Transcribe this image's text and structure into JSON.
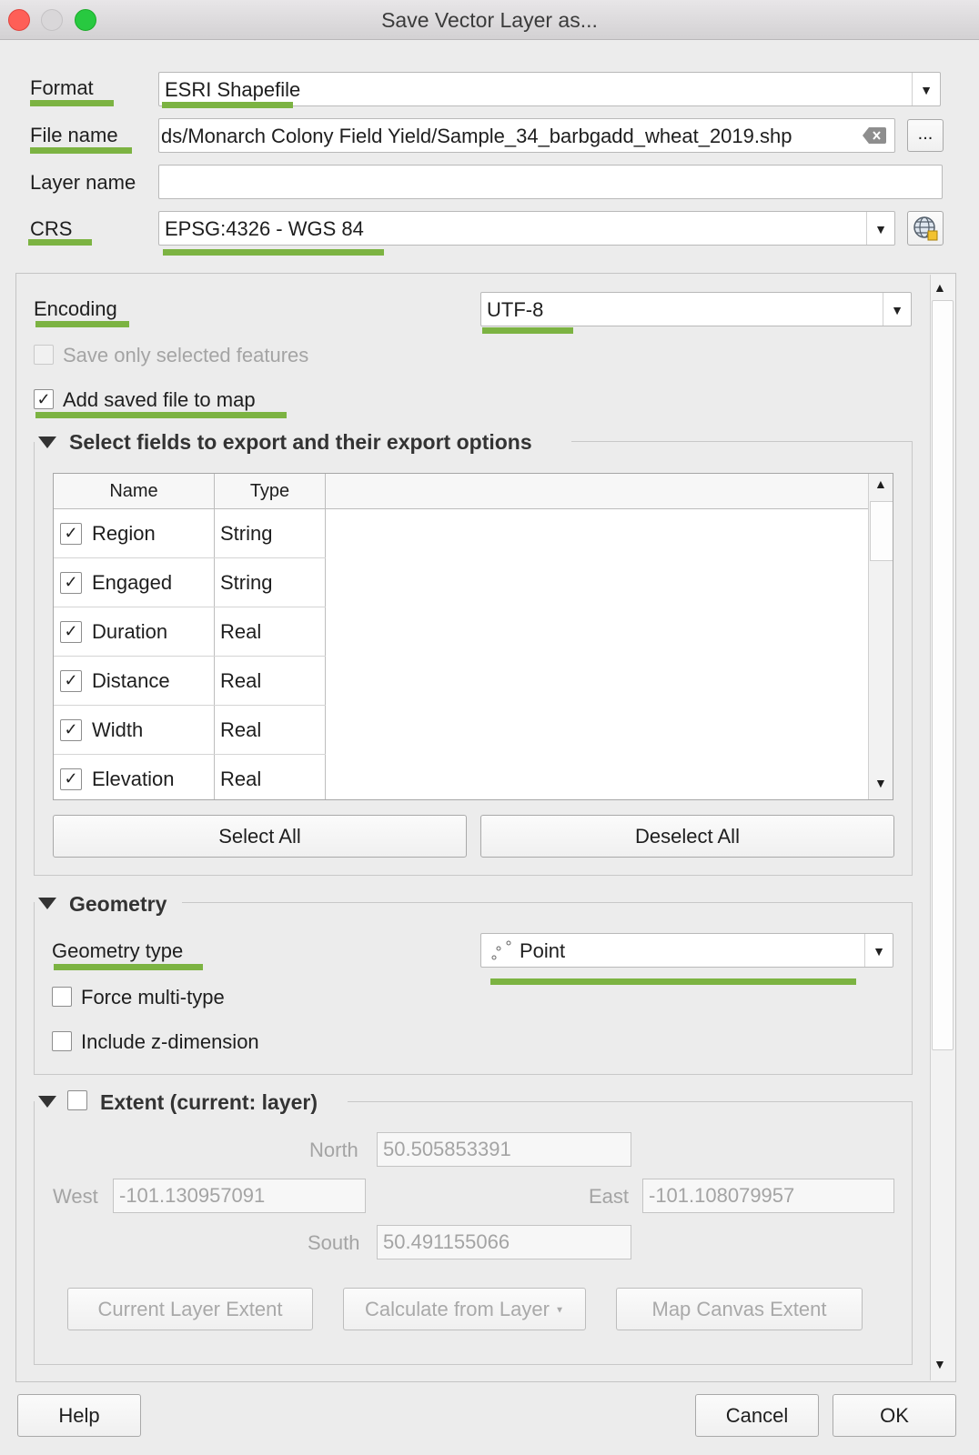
{
  "window": {
    "title": "Save Vector Layer as...",
    "colors": {
      "close": "#fe5f57",
      "minimize": "#d9d7d9",
      "zoom": "#28c940",
      "underline": "#7cb342"
    }
  },
  "form": {
    "format_label": "Format",
    "format_value": "ESRI Shapefile",
    "filename_label": "File name",
    "filename_value": "ds/Monarch Colony Field Yield/Sample_34_barbgadd_wheat_2019.shp",
    "browse_label": "...",
    "layername_label": "Layer name",
    "layername_value": "",
    "crs_label": "CRS",
    "crs_value": "EPSG:4326 - WGS 84"
  },
  "options": {
    "encoding_label": "Encoding",
    "encoding_value": "UTF-8",
    "save_selected_label": "Save only selected features",
    "add_to_map_label": "Add saved file to map",
    "add_to_map_checked": true
  },
  "fields_section": {
    "title": "Select fields to export and their export options",
    "columns": [
      "Name",
      "Type"
    ],
    "rows": [
      {
        "name": "Region",
        "type": "String"
      },
      {
        "name": "Engaged",
        "type": "String"
      },
      {
        "name": "Duration",
        "type": "Real"
      },
      {
        "name": "Distance",
        "type": "Real"
      },
      {
        "name": "Width",
        "type": "Real"
      },
      {
        "name": "Elevation",
        "type": "Real"
      }
    ],
    "select_all_label": "Select All",
    "deselect_all_label": "Deselect All"
  },
  "geometry": {
    "title": "Geometry",
    "type_label": "Geometry type",
    "type_value": "Point",
    "force_multi_label": "Force multi-type",
    "include_z_label": "Include z-dimension"
  },
  "extent": {
    "title": "Extent (current: layer)",
    "north_label": "North",
    "north_value": "50.505853391",
    "west_label": "West",
    "west_value": "-101.130957091",
    "east_label": "East",
    "east_value": "-101.108079957",
    "south_label": "South",
    "south_value": "50.491155066",
    "current_layer_btn": "Current Layer Extent",
    "calc_from_layer_btn": "Calculate from Layer",
    "map_canvas_btn": "Map Canvas Extent"
  },
  "footer": {
    "help_label": "Help",
    "cancel_label": "Cancel",
    "ok_label": "OK"
  }
}
